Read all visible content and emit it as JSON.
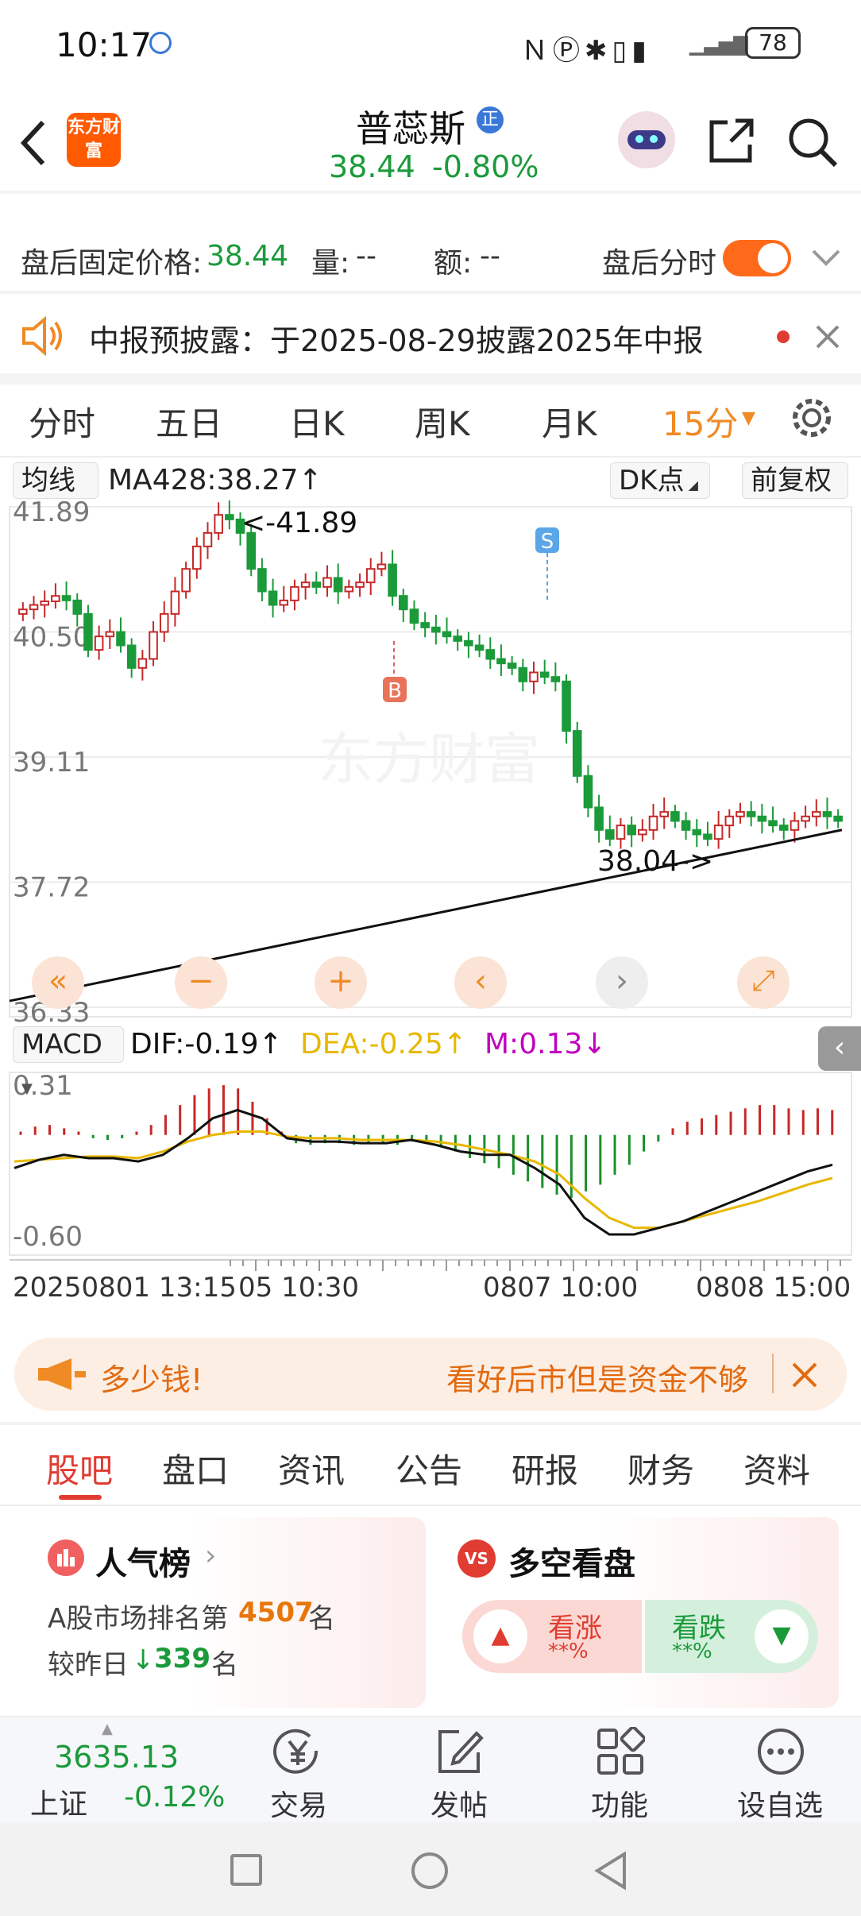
{
  "status_bar": {
    "time": "10:17",
    "battery": "78"
  },
  "header": {
    "title": "普蕊斯",
    "badge": "正",
    "logo_text": "东方财富",
    "price": "38.44",
    "change": "-0.80%"
  },
  "after_hours": {
    "fixed_price_label": "盘后固定价格:",
    "fixed_price": "38.44",
    "volume_label": "量:",
    "volume": "--",
    "amount_label": "额:",
    "amount": "--",
    "intraday_label": "盘后分时"
  },
  "notice": {
    "text": "中报预披露：于2025-08-29披露2025年中报"
  },
  "period_tabs": [
    "分时",
    "五日",
    "日K",
    "周K",
    "月K"
  ],
  "period_active": "15分",
  "chart_toolbar": {
    "ma_selector": "均线",
    "ma_value": "MA428:38.27↑",
    "dk_button": "DK点",
    "fq_button": "前复权"
  },
  "chart_data": [
    {
      "type": "candlestick",
      "yticks": [
        "41.89",
        "40.50",
        "39.11",
        "37.72",
        "36.33"
      ],
      "ylim": [
        36.33,
        41.89
      ],
      "high_annotation": "<-41.89",
      "low_annotation": "38.04->",
      "buy_marker": "B",
      "sell_marker": "S",
      "watermark": "东方财富"
    },
    {
      "type": "macd",
      "indicator": "MACD",
      "dif": "DIF:-0.19↑",
      "dea": "DEA:-0.25↑",
      "m": "M:0.13↓",
      "yticks": [
        "0.31",
        "-0.60"
      ],
      "ylim": [
        -0.6,
        0.31
      ],
      "x_labels": [
        "20250801 13:15",
        "05 10:30",
        "0807 10:00",
        "0808 15:00"
      ],
      "colors": {
        "dif": "#111111",
        "dea": "#e8b800",
        "m": "#c000c0",
        "up": "#c62828",
        "down": "#1b8f2a"
      }
    }
  ],
  "chart_controls": [
    "«",
    "−",
    "+",
    "‹",
    "›",
    "⤢"
  ],
  "ticker": {
    "left": "多少钱!",
    "right": "看好后市但是资金不够"
  },
  "bottom_tabs": {
    "items": [
      "股吧",
      "盘口",
      "资讯",
      "公告",
      "研报",
      "财务",
      "资料"
    ],
    "active": "股吧"
  },
  "popularity": {
    "title": "人气榜",
    "rank_prefix": "A股市场排名第",
    "rank": "4507",
    "rank_suffix": "名",
    "change_prefix": "较昨日",
    "change": "339",
    "change_suffix": "名"
  },
  "sentiment": {
    "title": "多空看盘",
    "bull_label": "看涨",
    "bull_value": "**%",
    "bear_label": "看跌",
    "bear_value": "**%"
  },
  "bottom_nav": {
    "index_value": "3635.13",
    "index_name": "上证",
    "index_change": "-0.12%",
    "items": [
      "交易",
      "发帖",
      "功能",
      "设自选"
    ]
  },
  "colors": {
    "brand": "#ff5a00",
    "up": "#e03c31",
    "down": "#1b9a3a",
    "accent": "#f08a24"
  }
}
